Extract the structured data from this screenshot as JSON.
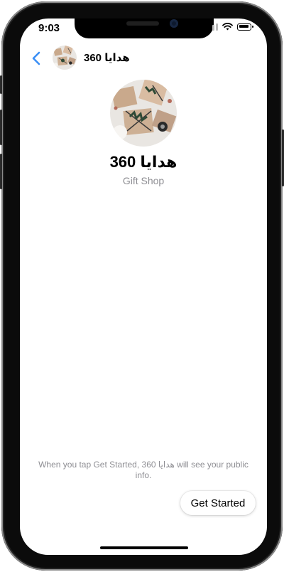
{
  "status_bar": {
    "time": "9:03",
    "icons": [
      "signal-icon",
      "wifi-icon",
      "battery-icon"
    ]
  },
  "header": {
    "back_icon": "chevron-left-icon",
    "title": "هدايا 360"
  },
  "profile": {
    "name": "هدايا 360",
    "category": "Gift Shop"
  },
  "footer": {
    "disclaimer": "When you tap Get Started, هدايا 360 will see your public info.",
    "get_started_label": "Get Started"
  },
  "colors": {
    "accent": "#3b8ff5",
    "secondary_text": "#8e8e93"
  }
}
